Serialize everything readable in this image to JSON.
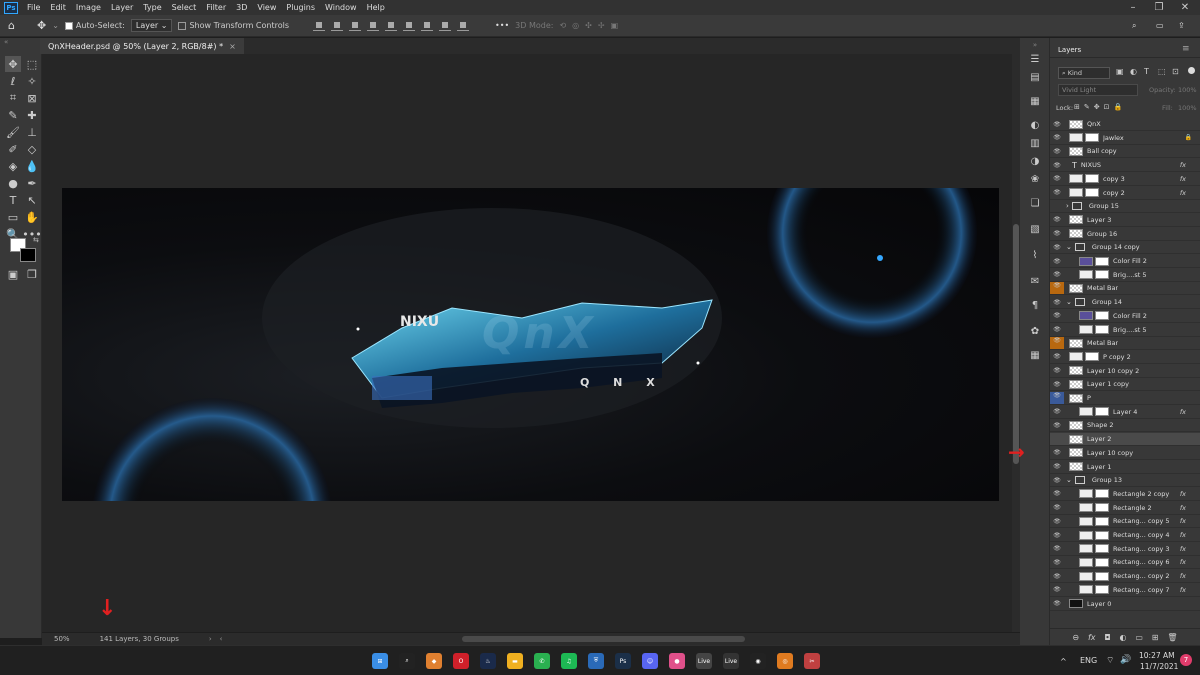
{
  "menu": [
    "File",
    "Edit",
    "Image",
    "Layer",
    "Type",
    "Select",
    "Filter",
    "3D",
    "View",
    "Plugins",
    "Window",
    "Help"
  ],
  "app_logo": "Ps",
  "options": {
    "auto_select_label": "Auto-Select:",
    "auto_select_value": "Layer",
    "transform_label": "Show Transform Controls",
    "mode_3d": "3D Mode:"
  },
  "document": {
    "tab_title": "QnXHeader.psd @ 50% (Layer 2, RGB/8#) *",
    "zoom": "50%",
    "status": "141 Layers, 30 Groups"
  },
  "artwork": {
    "logo_text": "QnX",
    "sub_text": "Q N X",
    "nixus_text": "NIXU"
  },
  "layers_panel": {
    "title": "Layers",
    "filter": "Kind",
    "blend_mode": "Vivid Light",
    "opacity_label": "Opacity:",
    "opacity_value": "100%",
    "lock_label": "Lock:",
    "fill_label": "Fill:",
    "fill_value": "100%",
    "rows": [
      {
        "name": "QnX",
        "type": "layer",
        "indent": 0,
        "fx": false
      },
      {
        "name": "Jawlex",
        "type": "masked",
        "indent": 0,
        "fx": false,
        "locked": true
      },
      {
        "name": "Ball copy",
        "type": "layer",
        "indent": 0,
        "fx": false
      },
      {
        "name": "NIXUS",
        "type": "text",
        "indent": 0,
        "fx": true
      },
      {
        "name": "copy 3",
        "type": "masked",
        "indent": 0,
        "fx": true
      },
      {
        "name": "copy 2",
        "type": "masked",
        "indent": 0,
        "fx": true
      },
      {
        "name": "Group 15",
        "type": "group",
        "indent": 0,
        "fx": false,
        "hidden": true
      },
      {
        "name": "Layer 3",
        "type": "layer",
        "indent": 0,
        "fx": false
      },
      {
        "name": "Group 16",
        "type": "layer",
        "indent": 0,
        "fx": false
      },
      {
        "name": "Group 14 copy",
        "type": "group-open",
        "indent": 0,
        "fx": false
      },
      {
        "name": "Color Fill 2",
        "type": "fill",
        "indent": 1,
        "fx": false
      },
      {
        "name": "Brig....st 5",
        "type": "adjust",
        "indent": 1,
        "fx": false
      },
      {
        "name": "Metal Bar",
        "type": "layer",
        "indent": 0,
        "fx": false,
        "orange": true
      },
      {
        "name": "Group 14",
        "type": "group-open",
        "indent": 0,
        "fx": false
      },
      {
        "name": "Color Fill 2",
        "type": "fill",
        "indent": 1,
        "fx": false
      },
      {
        "name": "Brig....st 5",
        "type": "adjust",
        "indent": 1,
        "fx": false
      },
      {
        "name": "Metal Bar",
        "type": "layer",
        "indent": 0,
        "fx": false,
        "orange": true
      },
      {
        "name": "P copy 2",
        "type": "masked",
        "indent": 0,
        "fx": false
      },
      {
        "name": "Layer 10 copy 2",
        "type": "layer",
        "indent": 0,
        "fx": false
      },
      {
        "name": "Layer 1 copy",
        "type": "layer",
        "indent": 0,
        "fx": false
      },
      {
        "name": "P",
        "type": "layer",
        "indent": 0,
        "fx": false,
        "blue": true
      },
      {
        "name": "Layer 4",
        "type": "masked",
        "indent": 1,
        "fx": true
      },
      {
        "name": "Shape 2",
        "type": "layer",
        "indent": 0,
        "fx": false
      },
      {
        "name": "Layer 2",
        "type": "layer",
        "indent": 0,
        "fx": false,
        "selected": true,
        "hidden": true
      },
      {
        "name": "Layer 10 copy",
        "type": "layer",
        "indent": 0,
        "fx": false
      },
      {
        "name": "Layer 1",
        "type": "layer",
        "indent": 0,
        "fx": false
      },
      {
        "name": "Group 13",
        "type": "group-open",
        "indent": 0,
        "fx": false
      },
      {
        "name": "Rectangle 2 copy",
        "type": "masked",
        "indent": 1,
        "fx": true
      },
      {
        "name": "Rectangle 2",
        "type": "masked",
        "indent": 1,
        "fx": true
      },
      {
        "name": "Rectang... copy 5",
        "type": "masked",
        "indent": 1,
        "fx": true
      },
      {
        "name": "Rectang... copy 4",
        "type": "masked",
        "indent": 1,
        "fx": true
      },
      {
        "name": "Rectang... copy 3",
        "type": "masked",
        "indent": 1,
        "fx": true
      },
      {
        "name": "Rectang... copy 6",
        "type": "masked",
        "indent": 1,
        "fx": true
      },
      {
        "name": "Rectang... copy 2",
        "type": "masked",
        "indent": 1,
        "fx": true
      },
      {
        "name": "Rectang... copy 7",
        "type": "masked",
        "indent": 1,
        "fx": true
      },
      {
        "name": "Layer 0",
        "type": "layer",
        "indent": 0,
        "fx": false,
        "dark": true
      }
    ]
  },
  "taskbar": {
    "lang": "ENG",
    "time": "10:27 AM",
    "date": "11/7/2021",
    "notification_count": "7",
    "apps": [
      "windows-start",
      "search",
      "photos",
      "opera",
      "steam",
      "files",
      "whatsapp",
      "spotify",
      "shield",
      "photoshop",
      "discord",
      "pink-app",
      "live1",
      "live2",
      "blender-like",
      "blender",
      "snip-tool"
    ]
  },
  "colors": {
    "accent": "#31a8ff",
    "orange": "#b8680f",
    "selected": "#4a4a4a",
    "annotation": "#e02020"
  }
}
